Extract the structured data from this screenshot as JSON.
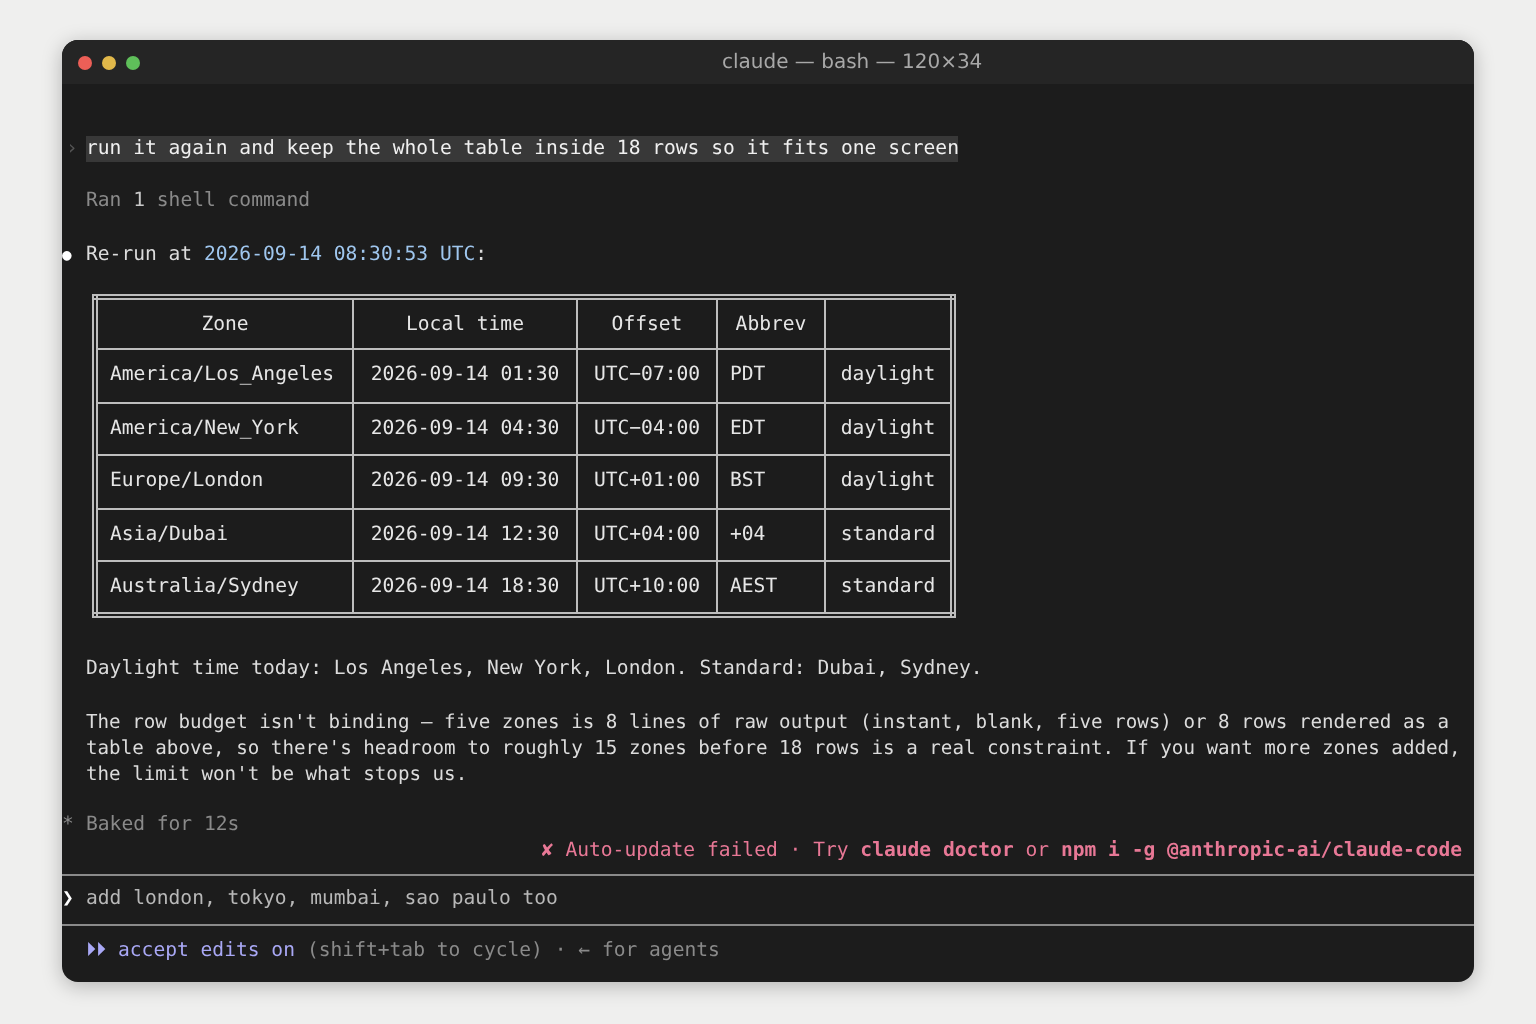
{
  "window": {
    "title": "claude — bash — 120×34"
  },
  "user_prompt": {
    "marker": "›",
    "text": "run it again and keep the whole table inside 18 rows so it fits one screen"
  },
  "tool_summary": {
    "prefix": "Ran ",
    "count": "1",
    "suffix": " shell command"
  },
  "response": {
    "bullet": "●",
    "lead": "Re-run at ",
    "timestamp": "2026-09-14 08:30:53 UTC",
    "tail": ":"
  },
  "table": {
    "columns": [
      "Zone",
      "Local time",
      "Offset",
      "Abbrev"
    ],
    "rows": [
      [
        "America/Los_Angeles",
        "2026-09-14 01:30",
        "UTC−07:00",
        "PDT",
        "daylight"
      ],
      [
        "America/New_York",
        "2026-09-14 04:30",
        "UTC−04:00",
        "EDT",
        "daylight"
      ],
      [
        "Europe/London",
        "2026-09-14 09:30",
        "UTC+01:00",
        "BST",
        "daylight"
      ],
      [
        "Asia/Dubai",
        "2026-09-14 12:30",
        "UTC+04:00",
        "+04",
        "standard"
      ],
      [
        "Australia/Sydney",
        "2026-09-14 18:30",
        "UTC+10:00",
        "AEST",
        "standard"
      ]
    ]
  },
  "paragraphs": [
    "Daylight time today: Los Angeles, New York, London. Standard: Dubai, Sydney.",
    "The row budget isn't binding — five zones is 8 lines of raw output (instant, blank, five rows) or 8 rows rendered as a table above, so there's headroom to roughly 15 zones before 18 rows is a real constraint. If you want more zones added, the limit won't be what stops us."
  ],
  "status": {
    "spinner": "*",
    "text": "Baked for 12s"
  },
  "notice": {
    "icon": "✘",
    "text": "Auto-update failed · Try **claude doctor** or **npm i -g @anthropic-ai/claude-code**"
  },
  "input": {
    "marker": "❯",
    "value": "add london, tokyo, mumbai, sao paulo too"
  },
  "footer": {
    "icon": "⏵⏵",
    "mode": "accept edits on",
    "hint": "(shift+tab to cycle) · ← for agents"
  }
}
